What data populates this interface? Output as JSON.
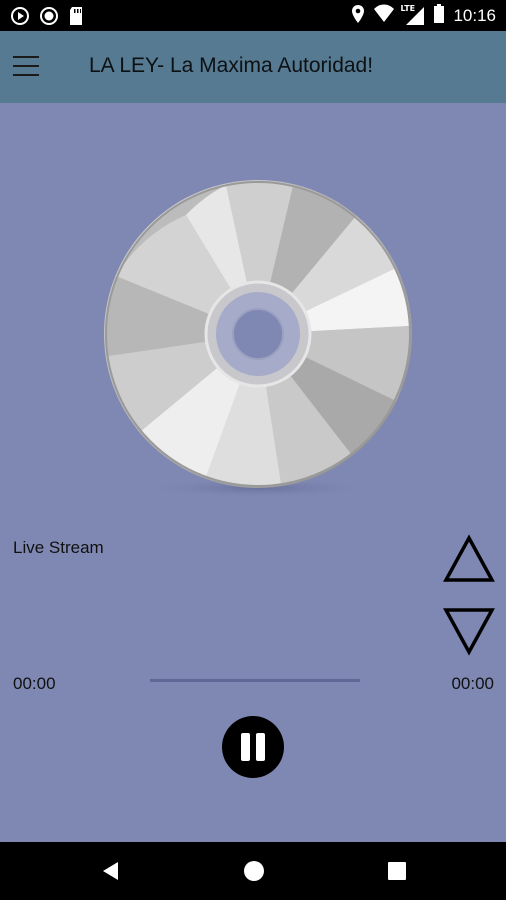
{
  "status_bar": {
    "time": "10:16",
    "lte_label": "LTE",
    "icons": [
      "play-notification-icon",
      "record-notification-icon",
      "sd-card-icon",
      "location-icon",
      "wifi-icon",
      "signal-icon",
      "battery-icon"
    ]
  },
  "toolbar": {
    "menu_icon": "hamburger-menu-icon",
    "title": "LA LEY- La Maxima Autoridad!"
  },
  "player": {
    "artwork": "cd-disc-icon",
    "track_label": "Live Stream",
    "elapsed": "00:00",
    "duration": "00:00",
    "progress": 0,
    "volume_up_icon": "triangle-up-icon",
    "volume_down_icon": "triangle-down-icon",
    "pause_icon": "pause-icon"
  },
  "nav_bar": {
    "icons": [
      "back-icon",
      "home-icon",
      "recents-icon"
    ]
  },
  "colors": {
    "background": "#7f88b2",
    "toolbar": "#557a91",
    "status_bar": "#000000",
    "nav_bar": "#000000"
  }
}
